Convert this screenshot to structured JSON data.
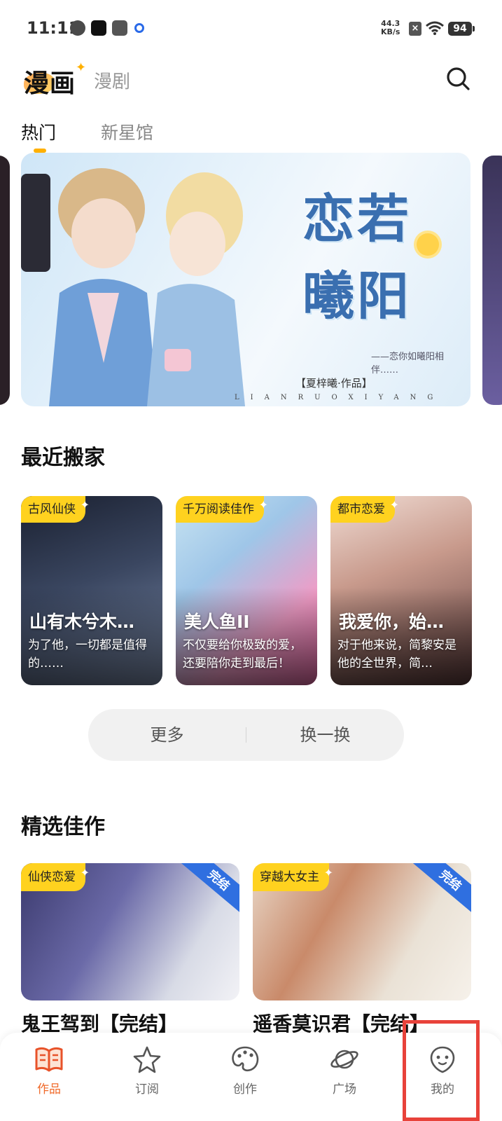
{
  "status_bar": {
    "time": "11:11",
    "net_speed_value": "44.3",
    "net_speed_unit": "KB/s",
    "battery": "94"
  },
  "header": {
    "brand": "漫画",
    "tab2": "漫剧"
  },
  "subtabs": {
    "active": "热门",
    "inactive": "新星馆"
  },
  "banner": {
    "title_line1": "恋若",
    "title_line2": "曦阳",
    "subtitle": "——恋你如曦阳相伴……",
    "author": "【夏梓曦·作品】",
    "latin": "LIANRUOXIYANG"
  },
  "recent": {
    "title": "最近搬家",
    "cards": [
      {
        "tag": "古风仙侠",
        "title": "山有木兮木…",
        "desc": "为了他，一切都是值得的……",
        "bg": "linear-gradient(160deg,#1a2030 0%,#3a4660 45%,#7a8aa8 100%)"
      },
      {
        "tag": "千万阅读佳作",
        "title": "美人鱼II",
        "desc": "不仅要给你极致的爱，还要陪你走到最后！",
        "bg": "linear-gradient(140deg,#c8e4f2 0%,#9fc6e8 35%,#f09cc6 70%,#e56aa6 100%)"
      },
      {
        "tag": "都市恋爱",
        "title": "我爱你，始…",
        "desc": "对于他来说，简黎安是他的全世界，简…",
        "bg": "linear-gradient(160deg,#f0dcd4 0%,#c89a8c 40%,#5a3a3a 100%)"
      }
    ]
  },
  "actions": {
    "more": "更多",
    "refresh": "换一换"
  },
  "featured": {
    "title": "精选佳作",
    "cards": [
      {
        "tag": "仙侠恋爱",
        "badge": "完结",
        "title": "鬼王驾到【完结】",
        "bg": "linear-gradient(120deg,#3b3a6e 0%,#6b6aa8 40%,#d8dbe6 75%,#f2f2f6 100%)"
      },
      {
        "tag": "穿越大女主",
        "badge": "完结",
        "title": "遥香莫识君【完结】",
        "bg": "linear-gradient(120deg,#e8d6c6 0%,#c98a6a 35%,#eae2d6 70%,#f6f1ea 100%)"
      }
    ]
  },
  "bottom_nav": [
    {
      "label": "作品",
      "icon": "book-icon",
      "active": true
    },
    {
      "label": "订阅",
      "icon": "star-icon",
      "active": false
    },
    {
      "label": "创作",
      "icon": "palette-icon",
      "active": false
    },
    {
      "label": "广场",
      "icon": "planet-icon",
      "active": false
    },
    {
      "label": "我的",
      "icon": "profile-face-icon",
      "active": false
    }
  ],
  "colors": {
    "accent": "#f06a2a",
    "tag_yellow": "#ffd21f",
    "highlight": "#e8423a"
  }
}
